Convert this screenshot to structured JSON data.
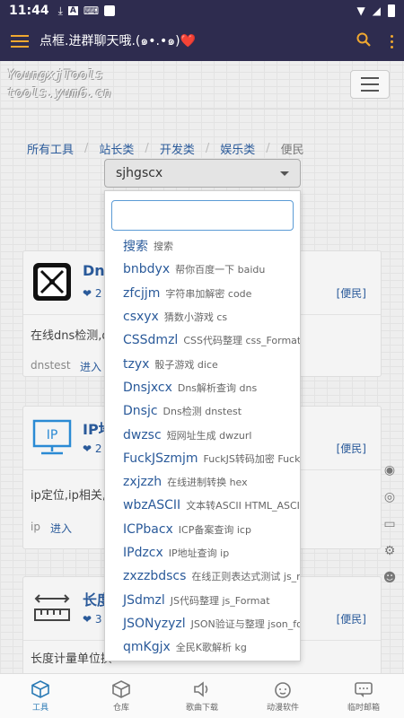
{
  "status_bar": {
    "time": "11:44",
    "icons": [
      "download-icon",
      "font-icon",
      "keyboard-icon",
      "app-square-icon"
    ],
    "right_icons": [
      "wifi-icon",
      "signal-icon",
      "battery-icon"
    ]
  },
  "app_bar": {
    "title": "点框.进群聊天哦.(๑•.•๑)❤️",
    "accent": "#f0a830",
    "background": "#2e2c4f"
  },
  "site": {
    "logo_line1": "YoungxjTools",
    "logo_line2": "tools.yum6.cn"
  },
  "breadcrumbs": [
    {
      "label": "所有工具"
    },
    {
      "label": "站长类"
    },
    {
      "label": "开发类"
    },
    {
      "label": "娱乐类"
    },
    {
      "label": "便民"
    }
  ],
  "select": {
    "value": "sjhgscx",
    "search_value": ""
  },
  "dropdown_items": [
    {
      "key": "搜索",
      "desc": "搜索"
    },
    {
      "key": "bnbdyx",
      "desc": "帮你百度一下 baidu"
    },
    {
      "key": "zfcjjm",
      "desc": "字符串加解密 code"
    },
    {
      "key": "csxyx",
      "desc": "猜数小游戏 cs"
    },
    {
      "key": "CSSdmzl",
      "desc": "CSS代码整理 css_Format"
    },
    {
      "key": "tzyx",
      "desc": "骰子游戏 dice"
    },
    {
      "key": "Dnsjxcx",
      "desc": "Dns解析查询 dns"
    },
    {
      "key": "Dnsjc",
      "desc": "Dns检测 dnstest"
    },
    {
      "key": "dwzsc",
      "desc": "短网址生成 dwzurl"
    },
    {
      "key": "FuckJSzmjm",
      "desc": "FuckJS转码加密 FuckJS"
    },
    {
      "key": "zxjzzh",
      "desc": "在线进制转换 hex"
    },
    {
      "key": "wbzASCII",
      "desc": "文本转ASCII HTML_ASCII"
    },
    {
      "key": "ICPbacx",
      "desc": "ICP备案查询 icp"
    },
    {
      "key": "IPdzcx",
      "desc": "IP地址查询 ip"
    },
    {
      "key": "zxzzbdscs",
      "desc": "在线正则表达式测试 js_reg"
    },
    {
      "key": "JSdmzl",
      "desc": "JS代码整理 js_Format"
    },
    {
      "key": "JSONyzyzl",
      "desc": "JSON验证与整理 json_format"
    },
    {
      "key": "qmKgjx",
      "desc": "全民K歌解析 kg"
    }
  ],
  "cards": [
    {
      "name": "Dns",
      "likes": "2",
      "category": "[便民]",
      "desc": "在线dns检测,d",
      "slug": "dnstest",
      "enter": "进入"
    },
    {
      "name": "IP地",
      "likes": "2",
      "category": "[便民]",
      "desc": "ip定位,ip相关,ip",
      "slug": "ip",
      "enter": "进入"
    },
    {
      "name": "长度",
      "likes": "3",
      "category": "[便民]",
      "desc": "长度计量单位换"
    }
  ],
  "bottom_nav": [
    {
      "label": "工具",
      "icon": "tools-cube-icon",
      "active": true
    },
    {
      "label": "仓库",
      "icon": "warehouse-box-icon",
      "active": false
    },
    {
      "label": "歌曲下载",
      "icon": "speaker-icon",
      "active": false
    },
    {
      "label": "动漫软件",
      "icon": "anime-face-icon",
      "active": false
    },
    {
      "label": "临时邮箱",
      "icon": "mail-chat-icon",
      "active": false
    }
  ]
}
